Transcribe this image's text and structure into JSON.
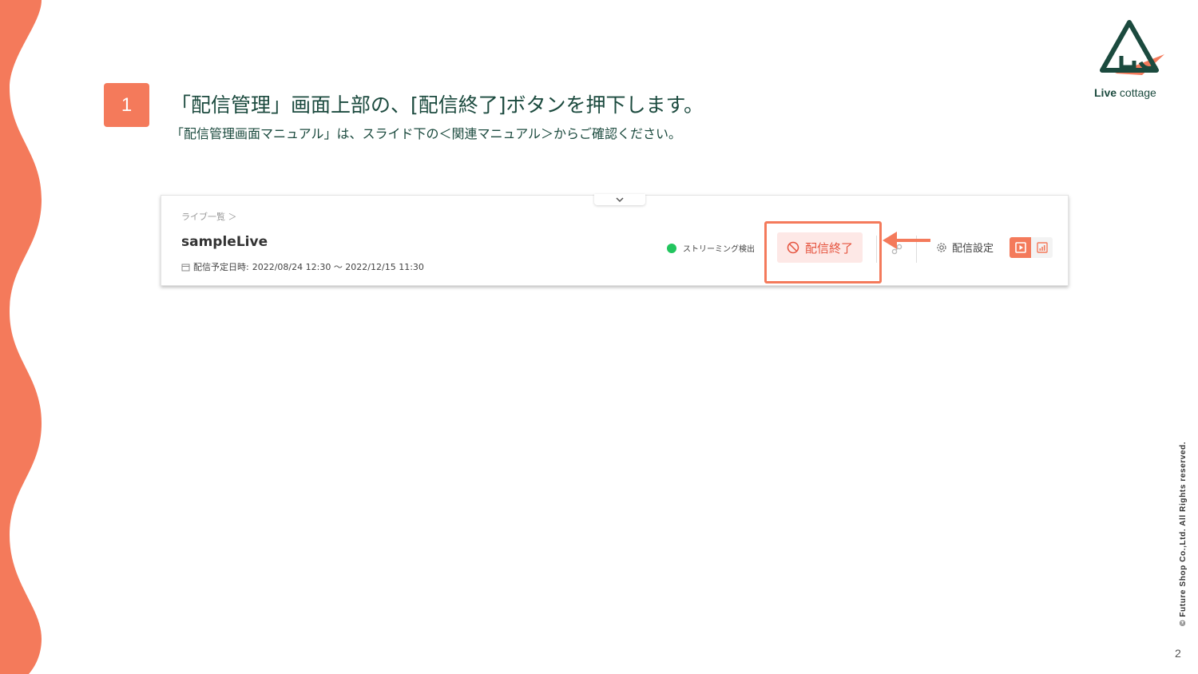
{
  "slide": {
    "step_number": "1",
    "title": "「配信管理」画面上部の、[配信終了]ボタンを押下します。",
    "subtitle": "「配信管理画面マニュアル」は、スライド下の＜関連マニュアル＞からご確認ください。",
    "page_number": "2",
    "copyright": "© Future Shop Co.,Ltd. All Rights reserved."
  },
  "logo": {
    "brand_bold": "Live",
    "brand_light": " cottage",
    "icon": "mountain-house-icon"
  },
  "screenshot": {
    "breadcrumb": "ライブ一覧 ＞",
    "live_name": "sampleLive",
    "schedule_label": "配信予定日時:",
    "schedule_value": "2022/08/24 12:30 〜 2022/12/15 11:30",
    "status_text": "ストリーミング検出",
    "end_button_label": "配信終了",
    "settings_label": "配信設定"
  },
  "colors": {
    "accent": "#f47a5b",
    "title_text": "#1b4a3e",
    "status_green": "#22c55e",
    "end_button_bg": "#fde8e6",
    "end_button_text": "#e5533e"
  }
}
